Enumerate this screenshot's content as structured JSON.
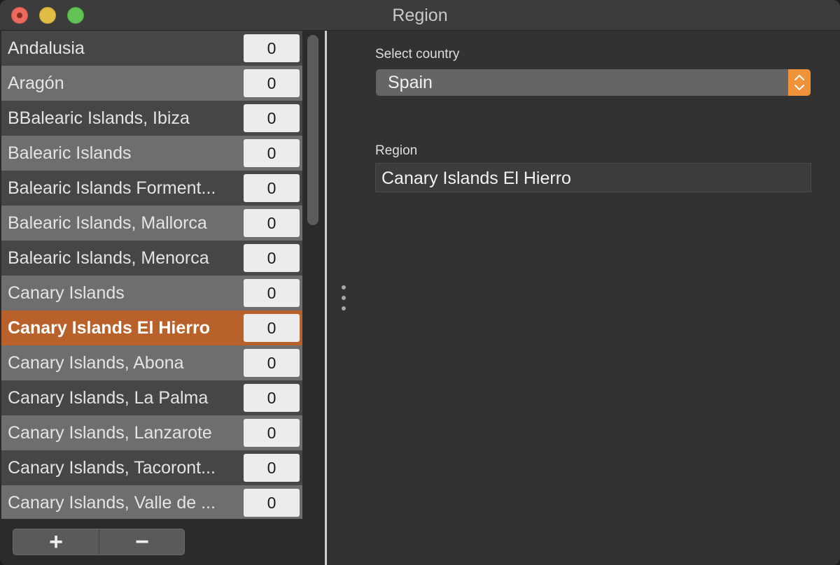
{
  "window": {
    "title": "Region"
  },
  "list": {
    "rows": [
      {
        "label": "Andalusia",
        "count": "0",
        "style": "dark"
      },
      {
        "label": "Aragón",
        "count": "0",
        "style": "light"
      },
      {
        "label": "BBalearic Islands, Ibiza",
        "count": "0",
        "style": "dark"
      },
      {
        "label": "Balearic Islands",
        "count": "0",
        "style": "light"
      },
      {
        "label": "Balearic Islands Forment...",
        "count": "0",
        "style": "dark"
      },
      {
        "label": "Balearic Islands, Mallorca",
        "count": "0",
        "style": "light"
      },
      {
        "label": "Balearic Islands, Menorca",
        "count": "0",
        "style": "dark"
      },
      {
        "label": "Canary Islands",
        "count": "0",
        "style": "light"
      },
      {
        "label": "Canary Islands El Hierro",
        "count": "0",
        "style": "sel"
      },
      {
        "label": "Canary Islands, Abona",
        "count": "0",
        "style": "light"
      },
      {
        "label": "Canary Islands, La Palma",
        "count": "0",
        "style": "dark"
      },
      {
        "label": "Canary Islands, Lanzarote",
        "count": "0",
        "style": "light"
      },
      {
        "label": "Canary Islands, Tacoront...",
        "count": "0",
        "style": "dark"
      },
      {
        "label": "Canary Islands, Valle de ...",
        "count": "0",
        "style": "light"
      }
    ],
    "selected_index": 8
  },
  "toolbar": {
    "add_label": "+",
    "remove_label": "−"
  },
  "form": {
    "country_label": "Select country",
    "country_value": "Spain",
    "region_label": "Region",
    "region_value": "Canary Islands El Hierro"
  },
  "colors": {
    "accent": "#f0923a",
    "selection": "#b8612a"
  }
}
